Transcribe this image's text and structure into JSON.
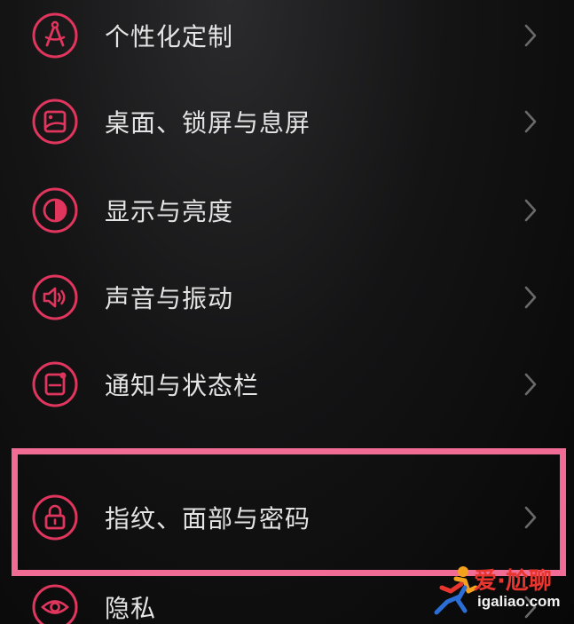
{
  "settings": {
    "items": [
      {
        "label": "个性化定制",
        "icon": "compass-icon"
      },
      {
        "label": "桌面、锁屏与息屏",
        "icon": "wallpaper-icon"
      },
      {
        "label": "显示与亮度",
        "icon": "contrast-icon"
      },
      {
        "label": "声音与振动",
        "icon": "speaker-icon"
      },
      {
        "label": "通知与状态栏",
        "icon": "notification-icon"
      },
      {
        "label": "指纹、面部与密码",
        "icon": "lock-icon"
      },
      {
        "label": "隐私",
        "icon": "eye-icon"
      }
    ]
  },
  "watermark": {
    "text": "爱·尬聊",
    "domain": "igaliao.com"
  },
  "colors": {
    "icon_accent": "#e0365e",
    "highlight": "#f06c94",
    "label": "#e4e4e4",
    "chevron": "#6a6a6a",
    "watermark_red": "#e8352e"
  }
}
